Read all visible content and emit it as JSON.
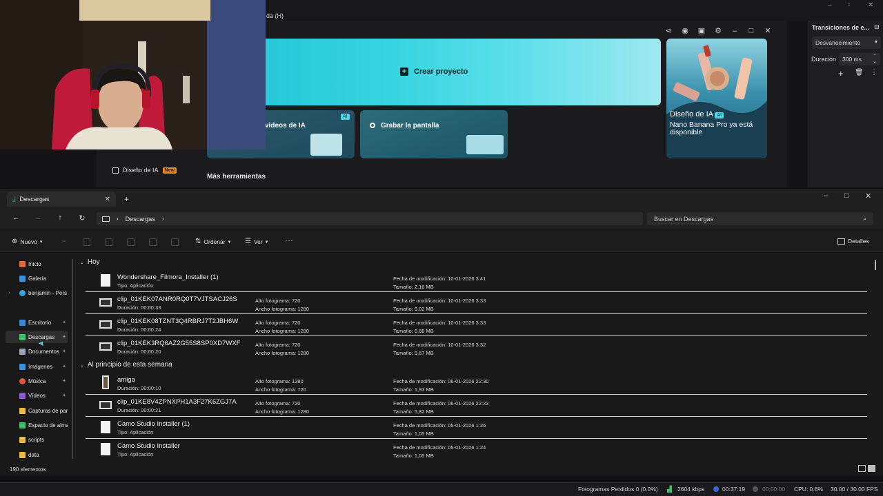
{
  "background_app": {
    "menu_fragment": "da (H)",
    "create_project": "Crear proyecto",
    "cards": [
      {
        "label": "videos de IA",
        "badge": "AI"
      },
      {
        "label": "Grabar la pantalla"
      }
    ],
    "promo": {
      "label": "Diseño de IA",
      "badge": "AI",
      "text": "Nano Banana Pro ya está disponible"
    },
    "sidebar_item": {
      "label": "Diseño de IA",
      "badge": "New"
    },
    "more_tools": "Más herramientas"
  },
  "transitions_panel": {
    "title": "Transiciones de e...",
    "type_value": "Desvanecimiento",
    "duration_label": "Duración",
    "duration_value": "300 ms"
  },
  "explorer": {
    "tab_title": "Descargas",
    "breadcrumb": [
      "Descargas"
    ],
    "search_placeholder": "Buscar en Descargas",
    "commands": {
      "new": "Nuevo",
      "sort": "Ordenar",
      "view": "Ver",
      "details": "Detalles"
    },
    "nav": [
      {
        "label": "Inicio",
        "color": "#e06a3c"
      },
      {
        "label": "Galería",
        "color": "#3a8fd6"
      },
      {
        "label": "benjamin - Pers",
        "color": "#3aa0e0"
      },
      {
        "label": "Escritorio",
        "color": "#3a86d0",
        "pinned": true
      },
      {
        "label": "Descargas",
        "color": "#3ec06a",
        "pinned": true,
        "selected": true
      },
      {
        "label": "Documentos",
        "color": "#9aa6b8",
        "pinned": true
      },
      {
        "label": "Imágenes",
        "color": "#3a8fd6",
        "pinned": true
      },
      {
        "label": "Música",
        "color": "#e0583c",
        "pinned": true
      },
      {
        "label": "Vídeos",
        "color": "#8a5ad6",
        "pinned": true
      },
      {
        "label": "Capturas de par",
        "color": "#e8b84a"
      },
      {
        "label": "Espacio de alma",
        "color": "#3ec06a"
      },
      {
        "label": "scripts",
        "color": "#e8b84a"
      },
      {
        "label": "data",
        "color": "#e8b84a"
      }
    ],
    "groups": [
      {
        "label": "Hoy",
        "files": [
          {
            "name": "Wondershare_Filmora_Installer (1)",
            "sub": "Tipo: Aplicación",
            "c2a": "",
            "c2b": "",
            "c3a": "Fecha de modificación: 10-01-2026 3:41",
            "c3b": "Tamaño: 2,16 MB",
            "kind": "app"
          },
          {
            "name": "clip_01KEK07ANR0RQ0T7VJTSACJ26S",
            "sub": "Duración: 00:00:33",
            "c2a": "Alto fotograma: 720",
            "c2b": "Ancho fotograma: 1280",
            "c3a": "Fecha de modificación: 10-01-2026 3:33",
            "c3b": "Tamaño: 9,02 MB",
            "kind": "video"
          },
          {
            "name": "clip_01KEK08TZNT3Q4RBRJ7T2JBH6W",
            "sub": "Duración: 00:00:24",
            "c2a": "Alto fotograma: 720",
            "c2b": "Ancho fotograma: 1280",
            "c3a": "Fecha de modificación: 10-01-2026 3:33",
            "c3b": "Tamaño: 6,66 MB",
            "kind": "video"
          },
          {
            "name": "clip_01KEK3RQ6AZ2G55S8SP0XD7WXF",
            "sub": "Duración: 00:00:20",
            "c2a": "Alto fotograma: 720",
            "c2b": "Ancho fotograma: 1280",
            "c3a": "Fecha de modificación: 10-01-2026 3:32",
            "c3b": "Tamaño: 5,67 MB",
            "kind": "video"
          }
        ]
      },
      {
        "label": "Al principio de esta semana",
        "files": [
          {
            "name": "amiga",
            "sub": "Duración: 00:00:10",
            "c2a": "Alto fotograma: 1280",
            "c2b": "Ancho fotograma: 720",
            "c3a": "Fecha de modificación: 06-01-2026 22:30",
            "c3b": "Tamaño: 1,93 MB",
            "kind": "portrait"
          },
          {
            "name": "clip_01KE8V4ZPNXPH1A3F27K6ZGJ7A",
            "sub": "Duración: 00:00:21",
            "c2a": "Alto fotograma: 720",
            "c2b": "Ancho fotograma: 1280",
            "c3a": "Fecha de modificación: 06-01-2026 22:22",
            "c3b": "Tamaño: 5,82 MB",
            "kind": "video"
          },
          {
            "name": "Camo Studio Installer (1)",
            "sub": "Tipo: Aplicación",
            "c2a": "",
            "c2b": "",
            "c3a": "Fecha de modificación: 05-01-2026 1:26",
            "c3b": "Tamaño: 1,05 MB",
            "kind": "app"
          },
          {
            "name": "Camo Studio Installer",
            "sub": "Tipo: Aplicación",
            "c2a": "",
            "c2b": "",
            "c3a": "Fecha de modificación: 05-01-2026 1:24",
            "c3b": "Tamaño: 1,05 MB",
            "kind": "app"
          }
        ]
      }
    ],
    "item_count": "190 elementos"
  },
  "obs_status": {
    "dropped": "Fotogramas Perdidos 0 (0.0%)",
    "bitrate": "2604 kbps",
    "rec_time": "00:37:19",
    "stream_time": "00:00:00",
    "cpu": "CPU: 0.6%",
    "fps": "30.00 / 30.00 FPS"
  }
}
